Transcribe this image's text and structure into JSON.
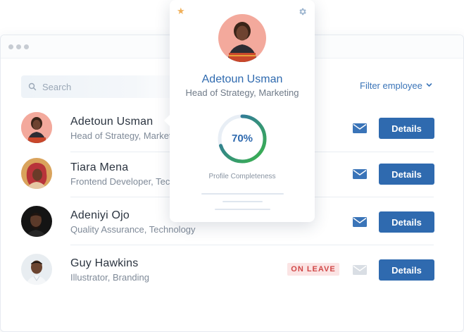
{
  "search": {
    "placeholder": "Search"
  },
  "filter": {
    "label": "Filter employee"
  },
  "employees": [
    {
      "name": "Adetoun Usman",
      "role": "Head of Strategy, Marketing",
      "details_label": "Details"
    },
    {
      "name": "Tiara Mena",
      "role": "Frontend Developer, Technology",
      "details_label": "Details"
    },
    {
      "name": "Adeniyi Ojo",
      "role": "Quality Assurance, Technology",
      "details_label": "Details"
    },
    {
      "name": "Guy Hawkins",
      "role": "Illustrator, Branding",
      "badge": "ON LEAVE",
      "details_label": "Details"
    }
  ],
  "popover": {
    "name": "Adetoun Usman",
    "role": "Head of Strategy, Marketing",
    "completeness_value": "70%",
    "completeness_fraction": 0.7,
    "completeness_caption": "Profile Completeness"
  },
  "colors": {
    "accent": "#2f6aaf",
    "ring_start": "#3bb54a",
    "ring_end": "#2f6aaf",
    "badge_bg": "#fbe4e4",
    "badge_text": "#d14848",
    "star": "#f0b05a"
  },
  "icons": [
    "search-icon",
    "chevron-down-icon",
    "mail-icon",
    "star-icon",
    "gear-icon"
  ]
}
